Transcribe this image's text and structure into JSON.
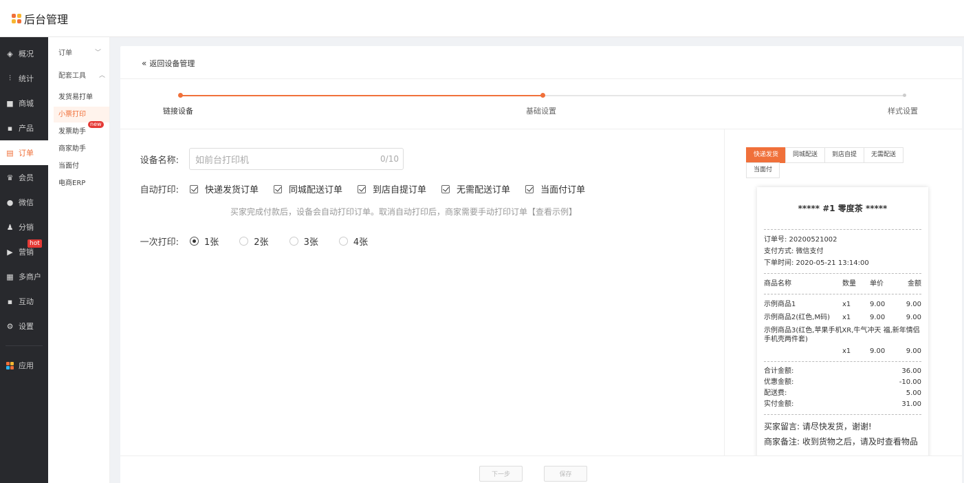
{
  "header": {
    "title": "后台管理",
    "logo_colors": [
      "#f0703a",
      "#f7b731",
      "#2db7f5",
      "#f0703a"
    ]
  },
  "sidebar": {
    "items": [
      {
        "label": "概况",
        "icon": "layers-icon",
        "glyph": "◈"
      },
      {
        "label": "统计",
        "icon": "chart-icon",
        "glyph": "⫶"
      },
      {
        "label": "商城",
        "icon": "shop-icon",
        "glyph": "■"
      },
      {
        "label": "产品",
        "icon": "grid-icon",
        "glyph": "▪"
      },
      {
        "label": "订单",
        "icon": "order-icon",
        "glyph": "▤",
        "active": true
      },
      {
        "label": "会员",
        "icon": "crown-icon",
        "glyph": "♛"
      },
      {
        "label": "微信",
        "icon": "wechat-icon",
        "glyph": "●"
      },
      {
        "label": "分销",
        "icon": "users-icon",
        "glyph": "♟"
      },
      {
        "label": "营销",
        "icon": "flag-icon",
        "glyph": "▶",
        "badge": "hot"
      },
      {
        "label": "多商户",
        "icon": "store-icon",
        "glyph": "▦"
      },
      {
        "label": "互动",
        "icon": "apps-icon",
        "glyph": "▪"
      },
      {
        "label": "设置",
        "icon": "gear-icon",
        "glyph": "⚙"
      }
    ],
    "bottom": {
      "label": "应用",
      "icon": "app-grid-icon"
    }
  },
  "subnav": {
    "group1": "订单",
    "group2": "配套工具",
    "items": [
      {
        "label": "发货易打单"
      },
      {
        "label": "小票打印",
        "active": true
      },
      {
        "label": "发票助手",
        "badge": "new"
      },
      {
        "label": "商家助手"
      },
      {
        "label": "当面付"
      },
      {
        "label": "电商ERP"
      }
    ]
  },
  "page": {
    "back_label": "返回设备管理",
    "steps": [
      "链接设备",
      "基础设置",
      "样式设置"
    ],
    "accent": "#f0703a"
  },
  "form": {
    "name_label": "设备名称:",
    "name_placeholder": "如前台打印机",
    "name_count": "0/10",
    "auto_label": "自动打印:",
    "auto_options": [
      "快递发货订单",
      "同城配送订单",
      "到店自提订单",
      "无需配送订单",
      "当面付订单"
    ],
    "hint": "买家完成付款后，设备会自动打印订单。取消自动打印后，商家需要手动打印订单【查看示例】",
    "copies_label": "一次打印:",
    "copies": [
      "1张",
      "2张",
      "3张",
      "4张"
    ],
    "copies_selected": "1张"
  },
  "preview": {
    "tabs": [
      "快递发货",
      "同城配送",
      "到店自提",
      "无需配送",
      "当面付"
    ],
    "active_tab": "快递发货",
    "title": "***** #1  零度茶 *****",
    "order_no": "订单号: 20200521002",
    "pay": "支付方式: 微信支付",
    "time": "下单时间: 2020-05-21 13:14:00",
    "head": {
      "name": "商品名称",
      "qty": "数量",
      "price": "单价",
      "amount": "金额"
    },
    "items": [
      {
        "name": "示例商品1",
        "qty": "x1",
        "price": "9.00",
        "amount": "9.00"
      },
      {
        "name": "示例商品2(红色,M码)",
        "qty": "x1",
        "price": "9.00",
        "amount": "9.00"
      },
      {
        "name": "示例商品3(红色,苹果手机XR,牛气冲天 福,新年情侣手机壳两件套)",
        "qty": "x1",
        "price": "9.00",
        "amount": "9.00"
      }
    ],
    "summary": [
      {
        "label": "合计金额:",
        "value": "36.00"
      },
      {
        "label": "优惠金额:",
        "value": "-10.00"
      },
      {
        "label": "配送费:",
        "value": "5.00"
      },
      {
        "label": "实付金额:",
        "value": "31.00"
      }
    ],
    "buyer_note": "买家留言: 请尽快发货，谢谢!",
    "seller_note": "商家备注: 收到货物之后，请及时查看物品"
  },
  "footer": {
    "next": "下一步",
    "save": "保存"
  }
}
